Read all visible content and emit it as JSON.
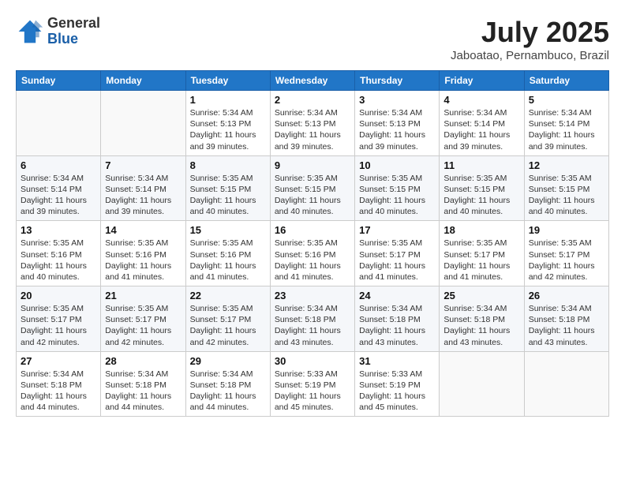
{
  "header": {
    "logo_general": "General",
    "logo_blue": "Blue",
    "title": "July 2025",
    "location": "Jaboatao, Pernambuco, Brazil"
  },
  "days_of_week": [
    "Sunday",
    "Monday",
    "Tuesday",
    "Wednesday",
    "Thursday",
    "Friday",
    "Saturday"
  ],
  "weeks": [
    [
      {
        "day": "",
        "info": ""
      },
      {
        "day": "",
        "info": ""
      },
      {
        "day": "1",
        "info": "Sunrise: 5:34 AM\nSunset: 5:13 PM\nDaylight: 11 hours and 39 minutes."
      },
      {
        "day": "2",
        "info": "Sunrise: 5:34 AM\nSunset: 5:13 PM\nDaylight: 11 hours and 39 minutes."
      },
      {
        "day": "3",
        "info": "Sunrise: 5:34 AM\nSunset: 5:13 PM\nDaylight: 11 hours and 39 minutes."
      },
      {
        "day": "4",
        "info": "Sunrise: 5:34 AM\nSunset: 5:14 PM\nDaylight: 11 hours and 39 minutes."
      },
      {
        "day": "5",
        "info": "Sunrise: 5:34 AM\nSunset: 5:14 PM\nDaylight: 11 hours and 39 minutes."
      }
    ],
    [
      {
        "day": "6",
        "info": "Sunrise: 5:34 AM\nSunset: 5:14 PM\nDaylight: 11 hours and 39 minutes."
      },
      {
        "day": "7",
        "info": "Sunrise: 5:34 AM\nSunset: 5:14 PM\nDaylight: 11 hours and 39 minutes."
      },
      {
        "day": "8",
        "info": "Sunrise: 5:35 AM\nSunset: 5:15 PM\nDaylight: 11 hours and 40 minutes."
      },
      {
        "day": "9",
        "info": "Sunrise: 5:35 AM\nSunset: 5:15 PM\nDaylight: 11 hours and 40 minutes."
      },
      {
        "day": "10",
        "info": "Sunrise: 5:35 AM\nSunset: 5:15 PM\nDaylight: 11 hours and 40 minutes."
      },
      {
        "day": "11",
        "info": "Sunrise: 5:35 AM\nSunset: 5:15 PM\nDaylight: 11 hours and 40 minutes."
      },
      {
        "day": "12",
        "info": "Sunrise: 5:35 AM\nSunset: 5:15 PM\nDaylight: 11 hours and 40 minutes."
      }
    ],
    [
      {
        "day": "13",
        "info": "Sunrise: 5:35 AM\nSunset: 5:16 PM\nDaylight: 11 hours and 40 minutes."
      },
      {
        "day": "14",
        "info": "Sunrise: 5:35 AM\nSunset: 5:16 PM\nDaylight: 11 hours and 41 minutes."
      },
      {
        "day": "15",
        "info": "Sunrise: 5:35 AM\nSunset: 5:16 PM\nDaylight: 11 hours and 41 minutes."
      },
      {
        "day": "16",
        "info": "Sunrise: 5:35 AM\nSunset: 5:16 PM\nDaylight: 11 hours and 41 minutes."
      },
      {
        "day": "17",
        "info": "Sunrise: 5:35 AM\nSunset: 5:17 PM\nDaylight: 11 hours and 41 minutes."
      },
      {
        "day": "18",
        "info": "Sunrise: 5:35 AM\nSunset: 5:17 PM\nDaylight: 11 hours and 41 minutes."
      },
      {
        "day": "19",
        "info": "Sunrise: 5:35 AM\nSunset: 5:17 PM\nDaylight: 11 hours and 42 minutes."
      }
    ],
    [
      {
        "day": "20",
        "info": "Sunrise: 5:35 AM\nSunset: 5:17 PM\nDaylight: 11 hours and 42 minutes."
      },
      {
        "day": "21",
        "info": "Sunrise: 5:35 AM\nSunset: 5:17 PM\nDaylight: 11 hours and 42 minutes."
      },
      {
        "day": "22",
        "info": "Sunrise: 5:35 AM\nSunset: 5:17 PM\nDaylight: 11 hours and 42 minutes."
      },
      {
        "day": "23",
        "info": "Sunrise: 5:34 AM\nSunset: 5:18 PM\nDaylight: 11 hours and 43 minutes."
      },
      {
        "day": "24",
        "info": "Sunrise: 5:34 AM\nSunset: 5:18 PM\nDaylight: 11 hours and 43 minutes."
      },
      {
        "day": "25",
        "info": "Sunrise: 5:34 AM\nSunset: 5:18 PM\nDaylight: 11 hours and 43 minutes."
      },
      {
        "day": "26",
        "info": "Sunrise: 5:34 AM\nSunset: 5:18 PM\nDaylight: 11 hours and 43 minutes."
      }
    ],
    [
      {
        "day": "27",
        "info": "Sunrise: 5:34 AM\nSunset: 5:18 PM\nDaylight: 11 hours and 44 minutes."
      },
      {
        "day": "28",
        "info": "Sunrise: 5:34 AM\nSunset: 5:18 PM\nDaylight: 11 hours and 44 minutes."
      },
      {
        "day": "29",
        "info": "Sunrise: 5:34 AM\nSunset: 5:18 PM\nDaylight: 11 hours and 44 minutes."
      },
      {
        "day": "30",
        "info": "Sunrise: 5:33 AM\nSunset: 5:19 PM\nDaylight: 11 hours and 45 minutes."
      },
      {
        "day": "31",
        "info": "Sunrise: 5:33 AM\nSunset: 5:19 PM\nDaylight: 11 hours and 45 minutes."
      },
      {
        "day": "",
        "info": ""
      },
      {
        "day": "",
        "info": ""
      }
    ]
  ]
}
